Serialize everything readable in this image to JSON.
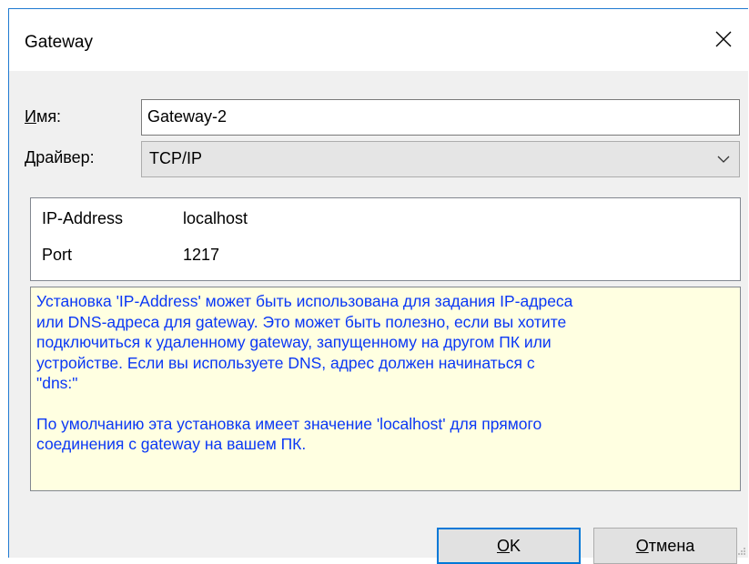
{
  "window": {
    "title": "Gateway"
  },
  "form": {
    "name_label": "Имя:",
    "name_label_accel": "И",
    "name_label_rest": "мя:",
    "name_value": "Gateway-2",
    "driver_label_accel": "Д",
    "driver_label_rest": "райвер:",
    "driver_value": "TCP/IP"
  },
  "properties": [
    {
      "key": "IP-Address",
      "value": "localhost"
    },
    {
      "key": "Port",
      "value": "1217"
    }
  ],
  "help": {
    "lines": [
      "Установка 'IP-Address' может быть использована для задания IP-адреса",
      "или DNS-адреса для gateway. Это может быть полезно, если вы хотите",
      "подключиться к удаленному gateway, запущенному на другом ПК или",
      "устройстве. Если вы используете DNS, адрес должен начинаться с",
      "\"dns:\""
    ],
    "lines2": [
      "По умолчанию эта установка имеет значение 'localhost' для прямого",
      "соединения с gateway на вашем ПК."
    ]
  },
  "buttons": {
    "ok_accel": "O",
    "ok_rest": "K",
    "cancel_accel": "О",
    "cancel_rest": "тмена"
  },
  "icons": {
    "close": "close-icon",
    "dropdown": "chevron-down-icon",
    "grip": "resize-grip-icon"
  }
}
